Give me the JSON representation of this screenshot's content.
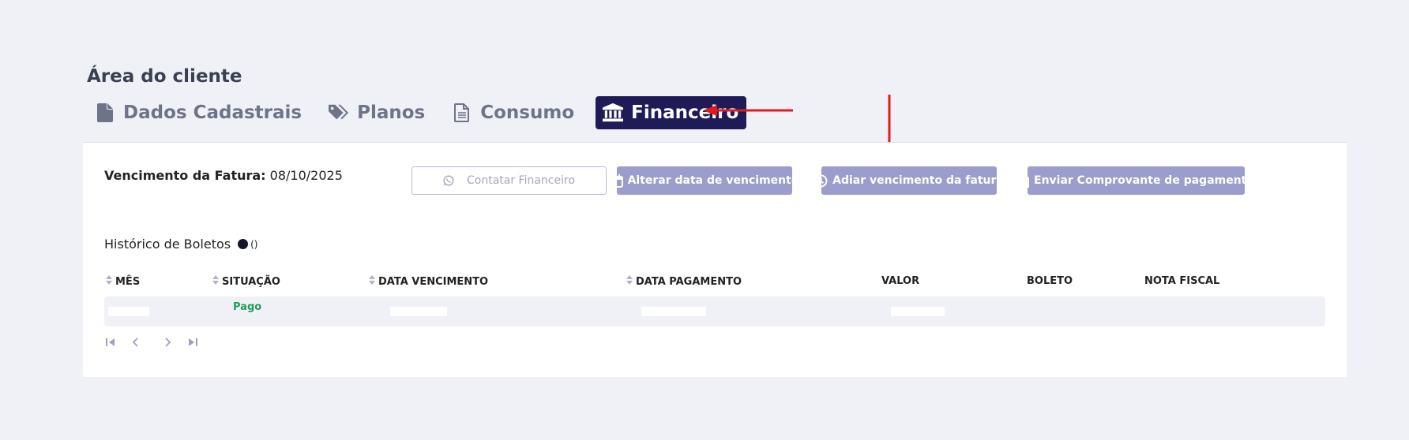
{
  "page": {
    "title": "Área do cliente"
  },
  "tabs": [
    {
      "label": "Dados Cadastrais",
      "icon": "file-icon",
      "active": false
    },
    {
      "label": "Planos",
      "icon": "tags-icon",
      "active": false
    },
    {
      "label": "Consumo",
      "icon": "document-icon",
      "active": false
    },
    {
      "label": "Financeiro",
      "icon": "bank-icon",
      "active": true
    }
  ],
  "invoice": {
    "due_label": "Vencimento da Fatura:",
    "due_value": "08/10/2025"
  },
  "actions": {
    "contact": "Contatar Financeiro",
    "change_due": "Alterar data de vencimento",
    "postpone": "Adiar vencimento da fatura",
    "send_receipt": "Enviar Comprovante de pagamento"
  },
  "history": {
    "title": "Histórico de Boletos",
    "count": "()"
  },
  "table": {
    "columns": [
      "MÊS",
      "SITUAÇÃO",
      "DATA VENCIMENTO",
      "DATA PAGAMENTO",
      "VALOR",
      "BOLETO",
      "NOTA FISCAL"
    ],
    "rows": [
      {
        "status": "Pago"
      }
    ]
  },
  "colors": {
    "accent": "#1e1b57",
    "button": "#9b9dcc",
    "paid": "#1f9d55",
    "annotation": "#e11b1b"
  }
}
